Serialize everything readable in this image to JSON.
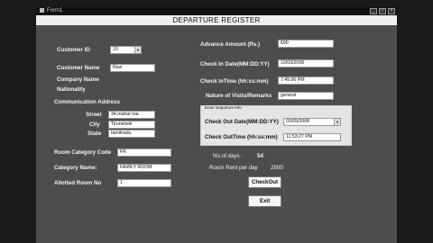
{
  "window": {
    "title": "Form1",
    "minimize": "_",
    "maximize": "□",
    "close": "×"
  },
  "header": {
    "title": "DEPARTURE REGISTER"
  },
  "left": {
    "customer_id_label": "Customer ID",
    "customer_id_value": "10",
    "customer_name_label": "Customer Name",
    "customer_name_value": "Ravi",
    "company_name_label": "Company Name",
    "nationality_label": "Nationality",
    "comm_address_label": "Communication Address",
    "street_label": "Street",
    "street_value": "34,mahat roa",
    "city_label": "City",
    "city_value": "Tirunelveli",
    "state_label": "State",
    "state_value": "tamilnadu",
    "room_category_code_label": "Room Category Code",
    "room_category_code_value": "FR",
    "category_name_label": "Category Name:",
    "category_name_value": "FAMILY ROOM",
    "allotted_room_label": "Allotted Room No",
    "allotted_room_value": "1"
  },
  "right": {
    "advance_amount_label": "Advance Amount (Rs.)",
    "advance_amount_value": "600",
    "checkin_date_label": "Check In Date(MM:DD:YY)",
    "checkin_date_value": "10/03/2008",
    "checkin_time_label": "Check InTime (hh:ss:mm)",
    "checkin_time_value": "7:45:56 PM",
    "nature_label": "Nature of Visits/Remarks",
    "nature_value": "general",
    "departure_group_label": "Enter Departure Info",
    "checkout_date_label": "Check Out Date(MM:DD:YY)",
    "checkout_date_value": "03/05/2008",
    "checkout_time_label": "Check OutTime (hh:ss:mm)",
    "checkout_time_value": "11:53:27 PM",
    "no_of_days_label": "No.of.days :",
    "no_of_days_value": "54",
    "room_rent_label": "Room Rent per day",
    "room_rent_value": "2500",
    "checkout_button": "CheckOut",
    "exit_button": "Exit"
  },
  "icons": {
    "dropdown": "chevron-down-icon",
    "app": "form-icon"
  }
}
